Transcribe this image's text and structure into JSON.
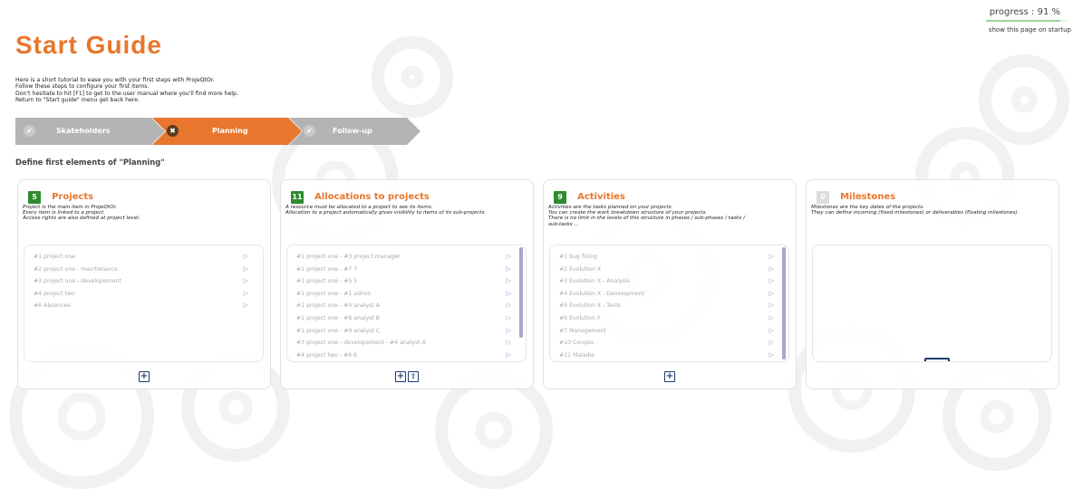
{
  "progress": {
    "label": "progress : 91 %",
    "value": 0.91
  },
  "show_startup": "show this page on startup",
  "title": "Start Guide",
  "intro": [
    "Here is a short tutorial to ease you with your first steps with ProjeQtOr.",
    "Follow these steps to configure your first items.",
    "Don't hesitate to hit [F1] to get to the user manual where you'll find more help.",
    "Return to \"Start guide\" menu get back here."
  ],
  "steps": [
    {
      "label": "Skateholders",
      "icon": "check-icon",
      "active": false
    },
    {
      "label": "Planning",
      "icon": "close-icon",
      "active": true
    },
    {
      "label": "Follow-up",
      "icon": "check-icon",
      "active": false
    }
  ],
  "define_title": "Define first elements of \"Planning\"",
  "colors": {
    "accent": "#e8762c",
    "badge": "#2e8b2e",
    "step_inactive": "#b4b4b4",
    "button": "#1f3a6e"
  },
  "cards": [
    {
      "count": "5",
      "title": "Projects",
      "desc": [
        "Project is the main item in ProjeQtOr.",
        "Every item is linked to a project.",
        "Access rights are also defined at project level."
      ],
      "items": [
        "#1 project one",
        "#2 project one - maintenance",
        "#3 project one - developement",
        "#4 project two",
        "#6 Absences"
      ]
    },
    {
      "count": "11",
      "title": "Allocations to projects",
      "desc": [
        "A resource must be allocated to a project to see its items.",
        "Allocation to a project automatically gives visibility to items of its sub-projects."
      ],
      "items": [
        "#1 project one - #3 project manager",
        "#1 project one - #7 7",
        "#1 project one - #5 5",
        "#1 project one - #1 admin",
        "#1 project one - #4 analyst A",
        "#1 project one - #8 analyst B",
        "#1 project one - #9 analyst C",
        "#3 project one - developement - #4 analyst A",
        "#4 project two - #6 6"
      ]
    },
    {
      "count": "9",
      "title": "Activities",
      "desc": [
        "Activities are the tasks planned on your projects.",
        "You can create the work breakdown structure of your projects.",
        "There is no limit in the levels of this structure in phases / sub-phases / tasks /",
        "sub-tasks ..."
      ],
      "items": [
        "#1 bug fixing",
        "#2 Evolution X",
        "#3 Evolutoin X - Analysis",
        "#4 Evolution X - Development",
        "#5 Evolution X - Tests",
        "#6 Evolution Y",
        "#7 Management",
        "#10 Congés",
        "#11 Maladie"
      ]
    },
    {
      "count": "0",
      "title": "Milestones",
      "desc": [
        "Milestones are the key dates of the projects.",
        "They can define incoming (fixed milestones) or deliverables (floating milestones)."
      ],
      "items": []
    }
  ]
}
